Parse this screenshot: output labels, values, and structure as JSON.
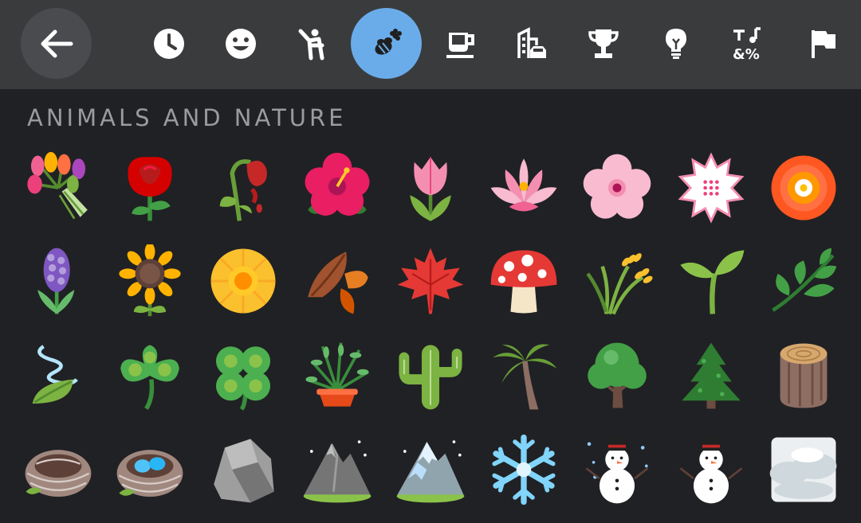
{
  "header": {
    "back_icon": "arrow-left-icon",
    "active_category": "nature",
    "categories": [
      {
        "id": "recent",
        "icon": "clock-icon"
      },
      {
        "id": "smileys",
        "icon": "smiley-icon"
      },
      {
        "id": "people",
        "icon": "person-waving-icon"
      },
      {
        "id": "nature",
        "icon": "bee-flower-icon"
      },
      {
        "id": "food",
        "icon": "coffee-cup-icon"
      },
      {
        "id": "travel",
        "icon": "buildings-car-icon"
      },
      {
        "id": "activities",
        "icon": "trophy-icon"
      },
      {
        "id": "objects",
        "icon": "lightbulb-icon"
      },
      {
        "id": "symbols",
        "icon": "symbols-icon"
      },
      {
        "id": "flags",
        "icon": "flag-icon"
      }
    ]
  },
  "section": {
    "title": "ANIMALS AND NATURE"
  },
  "emojis": [
    "bouquet",
    "rose",
    "wilted-flower",
    "hibiscus",
    "tulip",
    "lotus",
    "cherry-blossom",
    "white-flower",
    "marigold",
    "hyacinth",
    "sunflower",
    "blossom",
    "fallen-leaf",
    "maple-leaf",
    "mushroom",
    "sheaf-of-rice",
    "seedling",
    "herb",
    "leaf-fluttering-in-wind",
    "shamrock",
    "four-leaf-clover",
    "potted-plant",
    "cactus",
    "palm-tree",
    "deciduous-tree",
    "evergreen-tree",
    "wood",
    "empty-nest",
    "nest-with-eggs",
    "rock",
    "mountain",
    "snow-capped-mountain",
    "snowflake",
    "snowman",
    "snowman-without-snow",
    "fog"
  ],
  "colors": {
    "background": "#202124",
    "header": "#3a3b3d",
    "active_category": "#6aacea",
    "section_title": "#9a9b9d"
  }
}
